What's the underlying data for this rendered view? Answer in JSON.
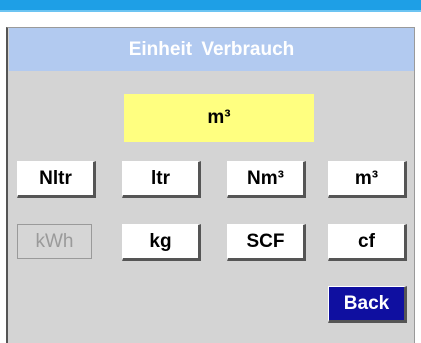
{
  "header": {
    "title": "Einheit  Verbrauch"
  },
  "display": {
    "value": "m³"
  },
  "units_row1": [
    "Nltr",
    "ltr",
    "Nm³",
    "m³"
  ],
  "units_row2": [
    "kWh",
    "kg",
    "SCF",
    "cf"
  ],
  "footer": {
    "back_label": "Back"
  },
  "colors": {
    "header_bg": "#b2caf0",
    "display_bg": "#ffff80",
    "back_bg": "#0f0fa0",
    "top_bar": "#1e9fe6"
  }
}
